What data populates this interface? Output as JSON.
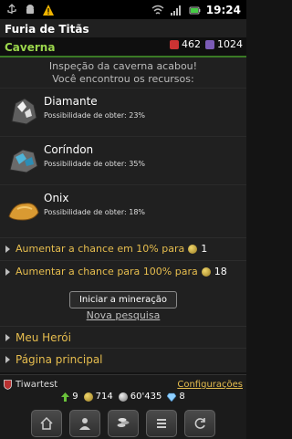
{
  "status": {
    "time": "19:24"
  },
  "app": {
    "title": "Furia de Titãs"
  },
  "section": {
    "label": "Caverna",
    "stat1": "462",
    "stat2": "1024"
  },
  "message": {
    "line1": "Inspeção da caverna acabou!",
    "line2": "Você encontrou os recursos:"
  },
  "resources": [
    {
      "name": "Diamante",
      "chance": "Possibilidade de obter: 23%",
      "icon": "diamond-ore-icon"
    },
    {
      "name": "Coríndon",
      "chance": "Possibilidade de obter: 35%",
      "icon": "corundum-ore-icon"
    },
    {
      "name": "Onix",
      "chance": "Possibilidade de obter: 18%",
      "icon": "onyx-ore-icon"
    }
  ],
  "actions": [
    {
      "text1": "Aumentar a chance",
      "text2": "em",
      "text3": "10% para",
      "cost": "1"
    },
    {
      "text1": "Aumentar a chance",
      "text2": "para",
      "text3": "100% para",
      "cost": "18"
    }
  ],
  "buttons": {
    "start": "Iniciar a mineração",
    "new_search": "Nova pesquisa"
  },
  "nav": {
    "hero": "Meu Herói",
    "home": "Página principal"
  },
  "player": {
    "name": "Tiwartest",
    "config": "Configurações"
  },
  "stats": {
    "level": "9",
    "gold": "714",
    "silver": "60'435",
    "gems": "8"
  },
  "colors": {
    "accent": "#e6bd4e",
    "section": "#9bd64c"
  }
}
